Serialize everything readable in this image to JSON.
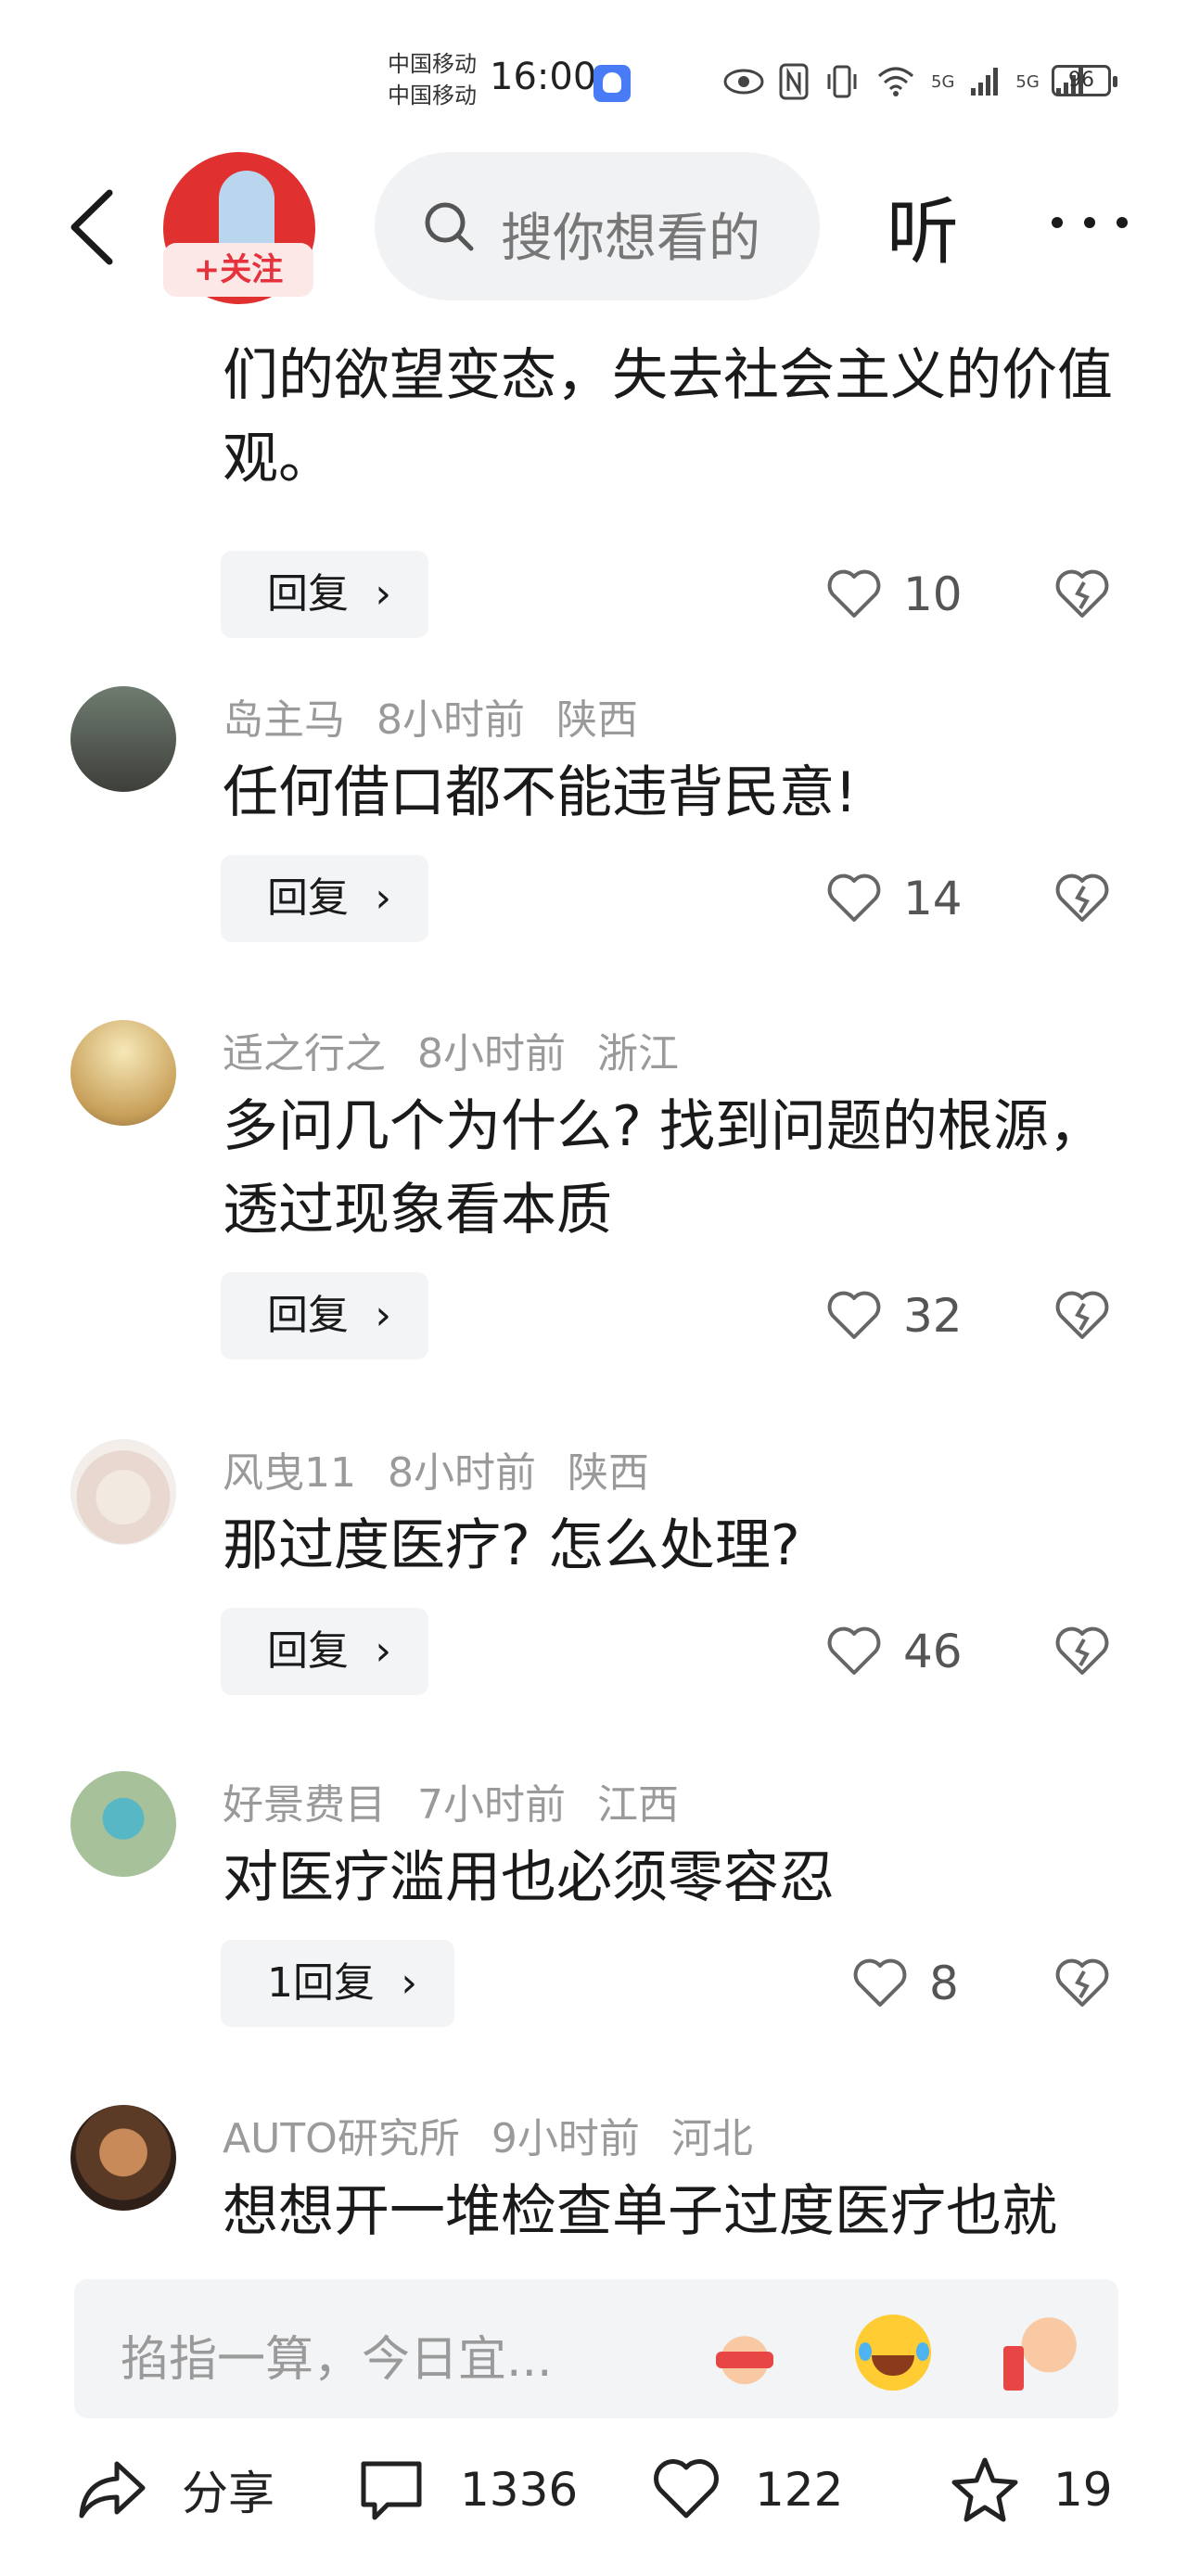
{
  "status_bar": {
    "carrier_1": "中国移动",
    "carrier_2": "中国移动",
    "time": "16:00",
    "network_1": "5G",
    "network_2": "5G",
    "battery": "96"
  },
  "header": {
    "follow_label": "+关注",
    "search_placeholder": "搜你想看的",
    "listen_label": "听"
  },
  "comments": [
    {
      "text": "们的欲望变态，失去社会主义的价值观。",
      "reply_label": "回复",
      "likes": "10"
    },
    {
      "user": "岛主马",
      "time": "8小时前",
      "location": "陕西",
      "text": "任何借口都不能违背民意!",
      "reply_label": "回复",
      "likes": "14"
    },
    {
      "user": "适之行之",
      "time": "8小时前",
      "location": "浙江",
      "text": "多问几个为什么? 找到问题的根源，透过现象看本质",
      "reply_label": "回复",
      "likes": "32"
    },
    {
      "user": "风曳11",
      "time": "8小时前",
      "location": "陕西",
      "text": "那过度医疗? 怎么处理?",
      "reply_label": "回复",
      "likes": "46"
    },
    {
      "user": "好景费目",
      "time": "7小时前",
      "location": "江西",
      "text": "对医疗滥用也必须零容忍",
      "reply_label": "1回复",
      "likes": "8"
    },
    {
      "user": "AUTO研究所",
      "time": "9小时前",
      "location": "河北",
      "text": "想想开一堆检查单子过度医疗也就"
    }
  ],
  "input_bar": {
    "placeholder": "掐指一算，今日宜..."
  },
  "bottom_bar": {
    "share_label": "分享",
    "comment_count": "1336",
    "like_count": "122",
    "favorite_count": "19"
  },
  "colors": {
    "accent_red": "#e5323d",
    "muted_text": "#9a9a9a",
    "button_bg": "#f3f4f6"
  }
}
